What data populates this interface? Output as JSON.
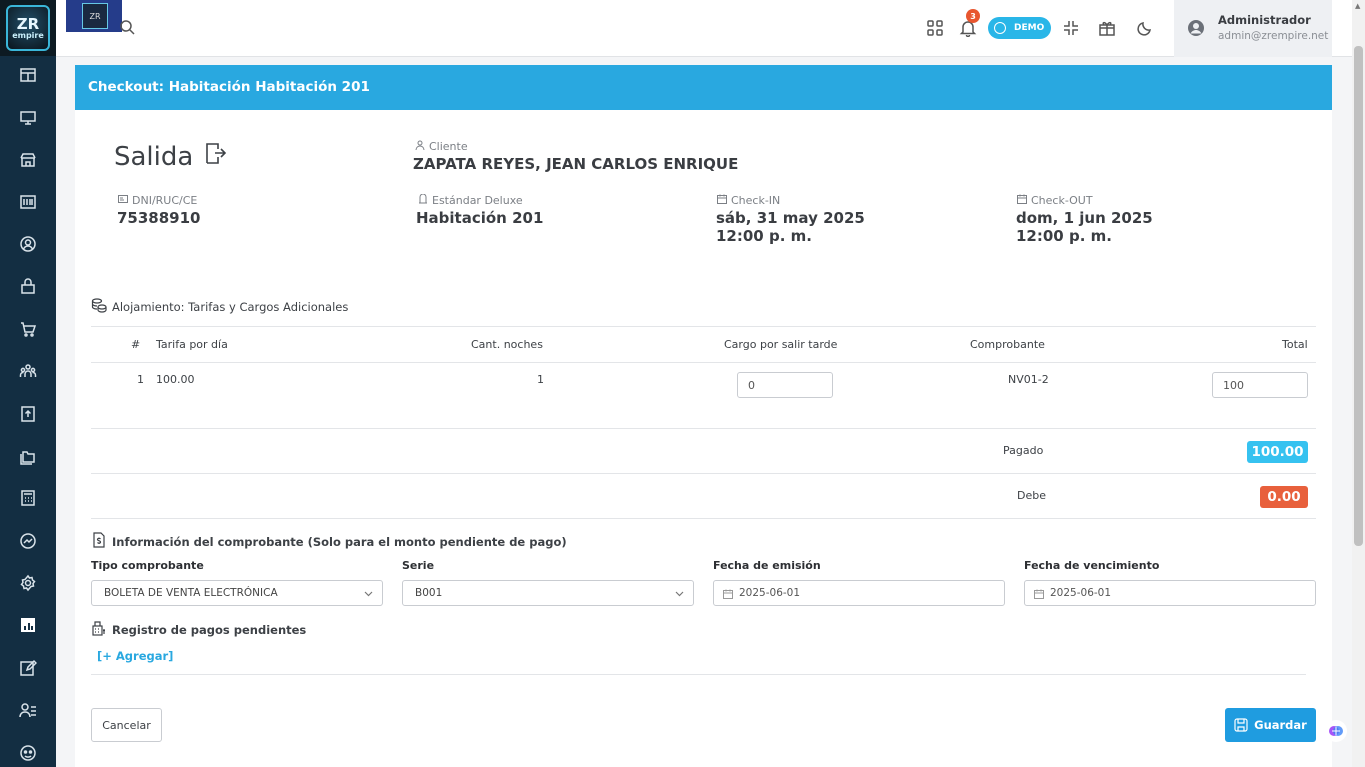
{
  "brand": {
    "logo_text": "ZR",
    "logo_sub": "empire",
    "thumb_text": "ZR"
  },
  "topbar": {
    "notification_count": "3",
    "demo_label": "DEMO",
    "user_name": "Administrador",
    "user_email": "admin@zrempire.net"
  },
  "card": {
    "header_title": "Checkout: Habitación Habitación 201",
    "salida_title": "Salida",
    "cliente_label": "Cliente",
    "cliente_value": "ZAPATA REYES, JEAN CARLOS ENRIQUE",
    "doc_label": "DNI/RUC/CE",
    "doc_value": "75388910",
    "room_type_label": "Estándar Deluxe",
    "room_value": "Habitación 201",
    "checkin_label": "Check-IN",
    "checkin_date": "sáb, 31 may 2025",
    "checkin_time": "12:00 p. m.",
    "checkout_label": "Check-OUT",
    "checkout_date": "dom, 1 jun 2025",
    "checkout_time": "12:00 p. m."
  },
  "alojamiento": {
    "title": "Alojamiento: Tarifas y Cargos Adicionales",
    "headers": {
      "num": "#",
      "tarifa": "Tarifa por día",
      "noches": "Cant. noches",
      "cargo": "Cargo por salir tarde",
      "comprobante": "Comprobante",
      "total": "Total"
    },
    "row": {
      "num": "1",
      "tarifa": "100.00",
      "noches": "1",
      "cargo": "0",
      "comprobante": "NV01-2",
      "total": "100"
    },
    "pagado_label": "Pagado",
    "pagado_value": "100.00",
    "debe_label": "Debe",
    "debe_value": "0.00"
  },
  "comprobante": {
    "title": "Información del comprobante (Solo para el monto pendiente de pago)",
    "tipo_label": "Tipo comprobante",
    "tipo_value": "BOLETA DE VENTA ELECTRÓNICA",
    "serie_label": "Serie",
    "serie_value": "B001",
    "emision_label": "Fecha de emisión",
    "emision_value": "2025-06-01",
    "vencimiento_label": "Fecha de vencimiento",
    "vencimiento_value": "2025-06-01"
  },
  "pagos": {
    "title": "Registro de pagos pendientes",
    "add_label": "[+ Agregar]"
  },
  "actions": {
    "cancel_label": "Cancelar",
    "save_label": "Guardar"
  },
  "colors": {
    "sidebar": "#132e42",
    "header": "#29a8e0",
    "pagado": "#36c2f0",
    "debe": "#e8603c",
    "save": "#1f9ce0"
  },
  "icons": {
    "sidebar": [
      "dashboard-icon",
      "monitor-icon",
      "store-icon",
      "barcode-icon",
      "user-circle-icon",
      "lock-icon",
      "cart-icon",
      "team-icon",
      "file-upload-icon",
      "folders-icon",
      "calculator-icon",
      "chart-icon",
      "settings-icon",
      "hotel-icon",
      "edit-icon",
      "user-list-icon",
      "support-icon"
    ]
  }
}
